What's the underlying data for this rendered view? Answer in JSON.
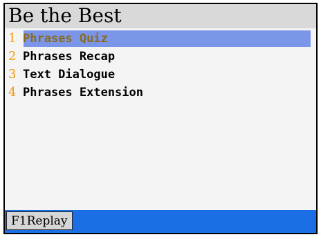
{
  "app": {
    "title": "Be the Best"
  },
  "menu": {
    "items": [
      {
        "number": "1",
        "label": "Phrases Quiz",
        "selected": true
      },
      {
        "number": "2",
        "label": "Phrases Recap",
        "selected": false
      },
      {
        "number": "3",
        "label": "Text Dialogue",
        "selected": false
      },
      {
        "number": "4",
        "label": "Phrases Extension",
        "selected": false
      }
    ]
  },
  "softkeys": {
    "left_label": "F1Replay"
  },
  "colors": {
    "selection": "#7b96e9",
    "number": "#f29a0e",
    "bottom_bar": "#1b6fe4",
    "title_bar": "#d9d9d9"
  }
}
